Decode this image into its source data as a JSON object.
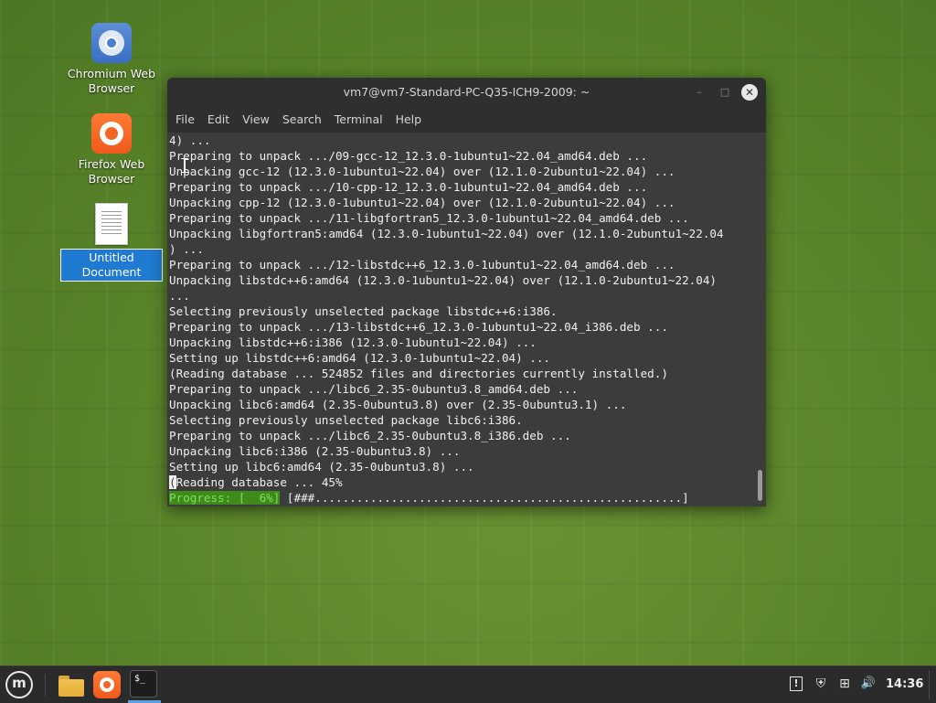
{
  "desktop": {
    "icons": [
      {
        "label_line1": "Chromium Web",
        "label_line2": "Browser",
        "icon": "chromium-icon"
      },
      {
        "label_line1": "Firefox Web",
        "label_line2": "Browser",
        "icon": "firefox-icon"
      },
      {
        "label_line1": "Untitled",
        "label_line2": "Document",
        "icon": "document-icon",
        "selected": true
      }
    ]
  },
  "window": {
    "title": "vm7@vm7-Standard-PC-Q35-ICH9-2009: ~",
    "controls": {
      "minimize": "–",
      "maximize": "□",
      "close": "✕"
    },
    "menu": [
      "File",
      "Edit",
      "View",
      "Search",
      "Terminal",
      "Help"
    ]
  },
  "terminal": {
    "lines": [
      "4) ...",
      "Preparing to unpack .../09-gcc-12_12.3.0-1ubuntu1~22.04_amd64.deb ...",
      "Unpacking gcc-12 (12.3.0-1ubuntu1~22.04) over (12.1.0-2ubuntu1~22.04) ...",
      "Preparing to unpack .../10-cpp-12_12.3.0-1ubuntu1~22.04_amd64.deb ...",
      "Unpacking cpp-12 (12.3.0-1ubuntu1~22.04) over (12.1.0-2ubuntu1~22.04) ...",
      "Preparing to unpack .../11-libgfortran5_12.3.0-1ubuntu1~22.04_amd64.deb ...",
      "Unpacking libgfortran5:amd64 (12.3.0-1ubuntu1~22.04) over (12.1.0-2ubuntu1~22.04",
      ") ...",
      "Preparing to unpack .../12-libstdc++6_12.3.0-1ubuntu1~22.04_amd64.deb ...",
      "Unpacking libstdc++6:amd64 (12.3.0-1ubuntu1~22.04) over (12.1.0-2ubuntu1~22.04)",
      "...",
      "Selecting previously unselected package libstdc++6:i386.",
      "Preparing to unpack .../13-libstdc++6_12.3.0-1ubuntu1~22.04_i386.deb ...",
      "Unpacking libstdc++6:i386 (12.3.0-1ubuntu1~22.04) ...",
      "Setting up libstdc++6:amd64 (12.3.0-1ubuntu1~22.04) ...",
      "(Reading database ... 524852 files and directories currently installed.)",
      "Preparing to unpack .../libc6_2.35-0ubuntu3.8_amd64.deb ...",
      "Unpacking libc6:amd64 (2.35-0ubuntu3.8) over (2.35-0ubuntu3.1) ...",
      "Selecting previously unselected package libc6:i386.",
      "Preparing to unpack .../libc6_2.35-0ubuntu3.8_i386.deb ...",
      "Unpacking libc6:i386 (2.35-0ubuntu3.8) ...",
      "Setting up libc6:amd64 (2.35-0ubuntu3.8) ..."
    ],
    "reading_line_cursor": "(",
    "reading_line_rest": "Reading database ... 45%",
    "progress_label": "Progress: [  6%]",
    "progress_bar": " [###.....................................................]"
  },
  "taskbar": {
    "menu_icon": "linux-mint-menu-icon",
    "apps": [
      "file-manager-icon",
      "firefox-icon",
      "terminal-icon"
    ],
    "terminal_glyph": "$_",
    "tray": {
      "update": "!",
      "shield": "⛨",
      "network": "⊞",
      "volume": "🔊"
    },
    "clock": "14:36"
  }
}
